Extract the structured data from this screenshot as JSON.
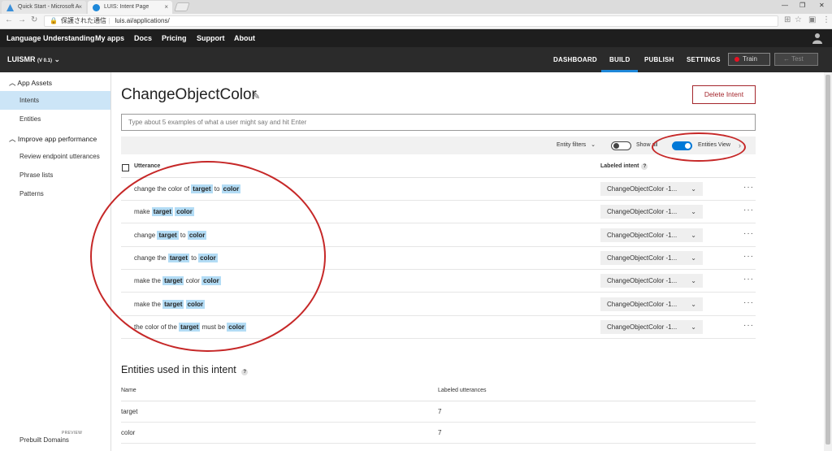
{
  "browser": {
    "tabs": [
      {
        "label": "Quick Start - Microsoft A",
        "active": false
      },
      {
        "label": "LUIS: Intent Page",
        "active": true
      }
    ],
    "close_glyph": "×",
    "address": {
      "security": "保護された通信",
      "url": "luis.ai/applications/"
    }
  },
  "topnav": {
    "items": [
      "Language Understanding",
      "My apps",
      "Docs",
      "Pricing",
      "Support",
      "About"
    ]
  },
  "app": {
    "name": "LUISMR",
    "version": "(V 0.1)",
    "tabs": [
      "DASHBOARD",
      "BUILD",
      "PUBLISH",
      "SETTINGS"
    ],
    "active_tab": "BUILD",
    "train_label": "Train",
    "test_label": "Test"
  },
  "sidebar": {
    "section1": "App Assets",
    "items1": [
      "Intents",
      "Entities"
    ],
    "section2": "Improve app performance",
    "items2": [
      "Review endpoint utterances",
      "Phrase lists",
      "Patterns"
    ],
    "prebuilt": "Prebuilt Domains",
    "preview": "PREVIEW"
  },
  "main": {
    "title": "ChangeObjectColor",
    "delete_label": "Delete Intent",
    "input_placeholder": "Type about 5 examples of what a user might say and hit Enter",
    "filters": {
      "entity_filters": "Entity filters",
      "show_all": "Show all",
      "entities_view": "Entities View"
    },
    "table": {
      "col_utterance": "Utterance",
      "col_labeled_intent": "Labeled intent",
      "rows": [
        {
          "parts": [
            [
              "change the color of ",
              false
            ],
            [
              "target",
              true
            ],
            [
              " to ",
              false
            ],
            [
              "color",
              true
            ]
          ],
          "intent": "ChangeObjectColor -1..."
        },
        {
          "parts": [
            [
              "make ",
              false
            ],
            [
              "target",
              true
            ],
            [
              " ",
              false
            ],
            [
              "color",
              true
            ]
          ],
          "intent": "ChangeObjectColor -1..."
        },
        {
          "parts": [
            [
              "change ",
              false
            ],
            [
              "target",
              true
            ],
            [
              " to ",
              false
            ],
            [
              "color",
              true
            ]
          ],
          "intent": "ChangeObjectColor -1..."
        },
        {
          "parts": [
            [
              "change the ",
              false
            ],
            [
              "target",
              true
            ],
            [
              " to ",
              false
            ],
            [
              "color",
              true
            ]
          ],
          "intent": "ChangeObjectColor -1..."
        },
        {
          "parts": [
            [
              "make the ",
              false
            ],
            [
              "target",
              true
            ],
            [
              " color ",
              false
            ],
            [
              "color",
              true
            ]
          ],
          "intent": "ChangeObjectColor -1..."
        },
        {
          "parts": [
            [
              "make the ",
              false
            ],
            [
              "target",
              true
            ],
            [
              " ",
              false
            ],
            [
              "color",
              true
            ]
          ],
          "intent": "ChangeObjectColor -1..."
        },
        {
          "parts": [
            [
              "the color of the ",
              false
            ],
            [
              "target",
              true
            ],
            [
              " must be ",
              false
            ],
            [
              "color",
              true
            ]
          ],
          "intent": "ChangeObjectColor -1..."
        }
      ]
    },
    "entities_section": {
      "title": "Entities used in this intent",
      "col_name": "Name",
      "col_labeled": "Labeled utterances",
      "rows": [
        {
          "name": "target",
          "count": "7"
        },
        {
          "name": "color",
          "count": "7"
        }
      ]
    }
  },
  "colors": {
    "accent": "#0078d7",
    "entity_highlight": "#b3dcf5",
    "annotation": "#c62828",
    "delete": "#a4262c"
  },
  "icons": {
    "pencil": "pencil-icon",
    "chevron": "chevron-down-icon",
    "more": "more-icon",
    "help": "help-icon"
  }
}
